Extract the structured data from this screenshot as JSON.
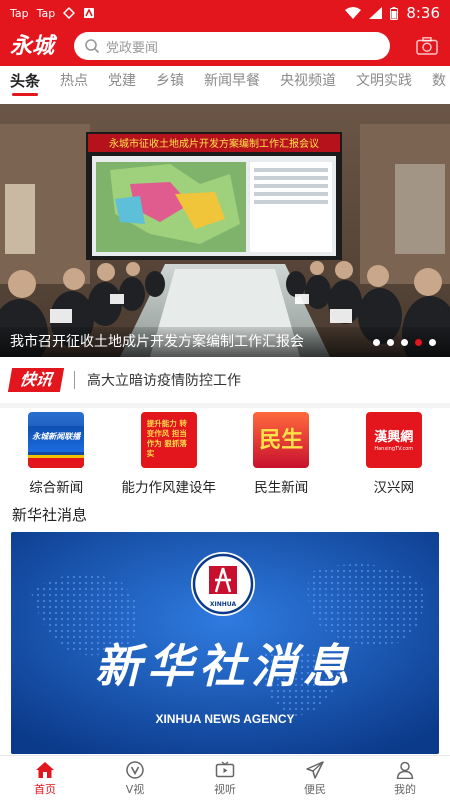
{
  "status_bar": {
    "left_items": [
      "Tap",
      "Tap"
    ],
    "time": "8:36"
  },
  "header": {
    "logo_text": "永城",
    "search_placeholder": "党政要闻"
  },
  "tabs": [
    {
      "label": "头条",
      "active": true
    },
    {
      "label": "热点"
    },
    {
      "label": "党建"
    },
    {
      "label": "乡镇"
    },
    {
      "label": "新闻早餐"
    },
    {
      "label": "央视频道"
    },
    {
      "label": "文明实践"
    },
    {
      "label": "数"
    }
  ],
  "banner": {
    "screen_title": "永城市征收土地成片开发方案编制工作汇报会议",
    "caption": "我市召开征收土地成片开发方案编制工作汇报会",
    "dot_count": 5,
    "active_dot": 4
  },
  "kuaixun": {
    "badge": "快讯",
    "text": "高大立暗访疫情防控工作"
  },
  "grid": [
    {
      "label": "综合新闻",
      "icon_text": "永城新闻联播"
    },
    {
      "label": "能力作风建设年",
      "icon_text": "提升能力 转变作风 担当作为 狠抓落实"
    },
    {
      "label": "民生新闻",
      "icon_text": "民生"
    },
    {
      "label": "汉兴网",
      "icon_text": "漢興網",
      "icon_subtext": "HanxingTV.com"
    }
  ],
  "section": {
    "title": "新华社消息"
  },
  "xinhua": {
    "calligraphy": "新华社消息",
    "agency": "XINHUA NEWS AGENCY",
    "logo_text": "XINHUA"
  },
  "nav": [
    {
      "label": "首页",
      "icon": "home-icon",
      "active": true
    },
    {
      "label": "V视",
      "icon": "v-video-icon"
    },
    {
      "label": "视听",
      "icon": "tv-icon"
    },
    {
      "label": "便民",
      "icon": "send-icon"
    },
    {
      "label": "我的",
      "icon": "user-icon"
    }
  ],
  "colors": {
    "accent": "#e3151d",
    "xinhua_blue": "#1450a8"
  }
}
